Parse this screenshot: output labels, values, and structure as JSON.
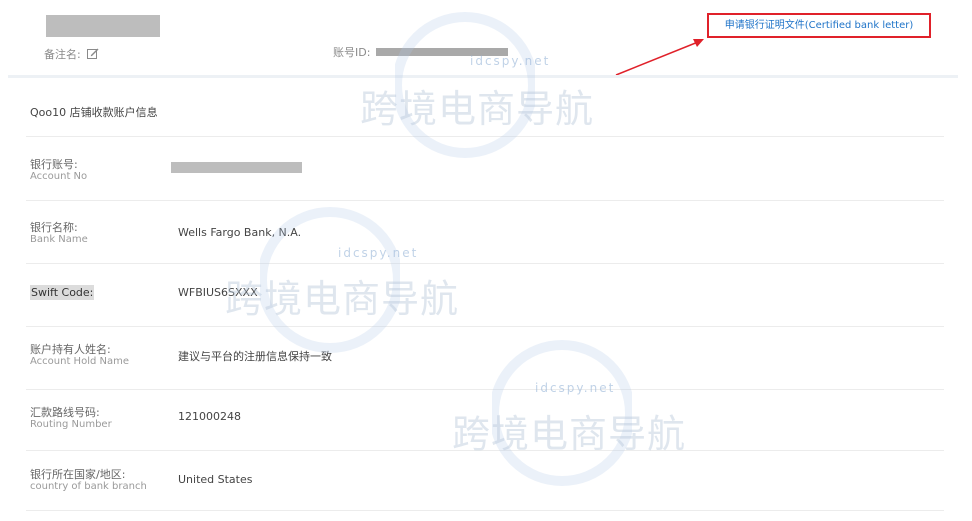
{
  "header": {
    "remark_label": "备注名:",
    "account_id_label": "账号ID:",
    "apply_button": "申请银行证明文件(Certified bank letter)"
  },
  "section": {
    "title": "Qoo10 店铺收款账户信息"
  },
  "rows": [
    {
      "label_cn": "银行账号:",
      "label_en": "Account No",
      "value": ""
    },
    {
      "label_cn": "银行名称:",
      "label_en": "Bank Name",
      "value": "Wells Fargo Bank, N.A."
    },
    {
      "label_cn": "Swift Code:",
      "label_en": "",
      "value": "WFBIUS6SXXX"
    },
    {
      "label_cn": "账户持有人姓名:",
      "label_en": "Account Hold Name",
      "value": "建议与平台的注册信息保持一致"
    },
    {
      "label_cn": "汇款路线号码:",
      "label_en": "Routing Number",
      "value": "121000248"
    },
    {
      "label_cn": "银行所在国家/地区:",
      "label_en": "country of bank branch",
      "value": "United States"
    }
  ],
  "watermark": {
    "main": "跨境电商导航",
    "sub": "idcspy.net"
  },
  "colors": {
    "accent_link": "#1e73c8",
    "highlight_border": "#e0212a"
  }
}
